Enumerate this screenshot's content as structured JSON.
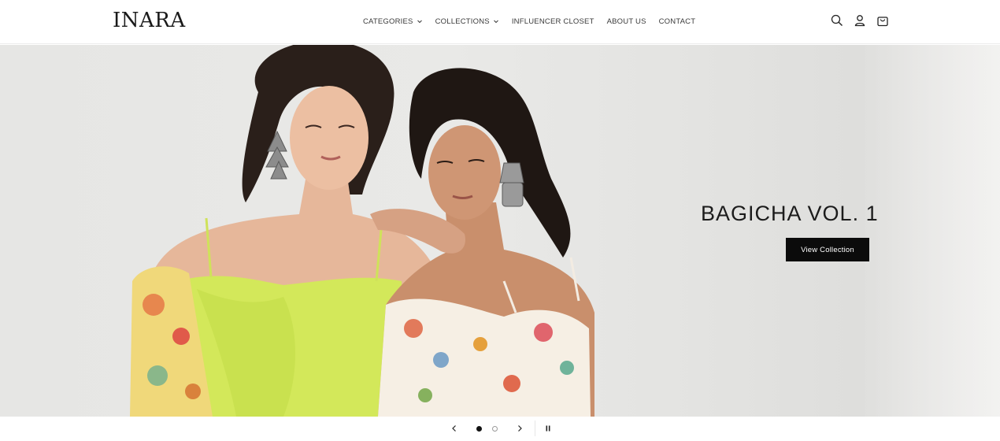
{
  "brand": {
    "logo_text": "INARA"
  },
  "nav": {
    "items": [
      {
        "label": "CATEGORIES",
        "has_dropdown": true
      },
      {
        "label": "COLLECTIONS",
        "has_dropdown": true
      },
      {
        "label": "INFLUENCER CLOSET",
        "has_dropdown": false
      },
      {
        "label": "ABOUT US",
        "has_dropdown": false
      },
      {
        "label": "CONTACT",
        "has_dropdown": false
      }
    ]
  },
  "header_icons": [
    "search-icon",
    "account-icon",
    "cart-icon"
  ],
  "hero": {
    "heading": "BAGICHA VOL. 1",
    "cta_label": "View Collection",
    "image_description_icon": "two-models-photo"
  },
  "slider": {
    "slide_count": 2,
    "active_slide": 1,
    "controls": [
      "chevron-left-icon",
      "chevron-right-icon",
      "pause-icon"
    ]
  },
  "colors": {
    "text": "#121212",
    "cta_bg": "#0b0b0b",
    "cta_text": "#ffffff",
    "hero_bg": "#e8e8e6",
    "dress_lime": "#d3e85a"
  }
}
